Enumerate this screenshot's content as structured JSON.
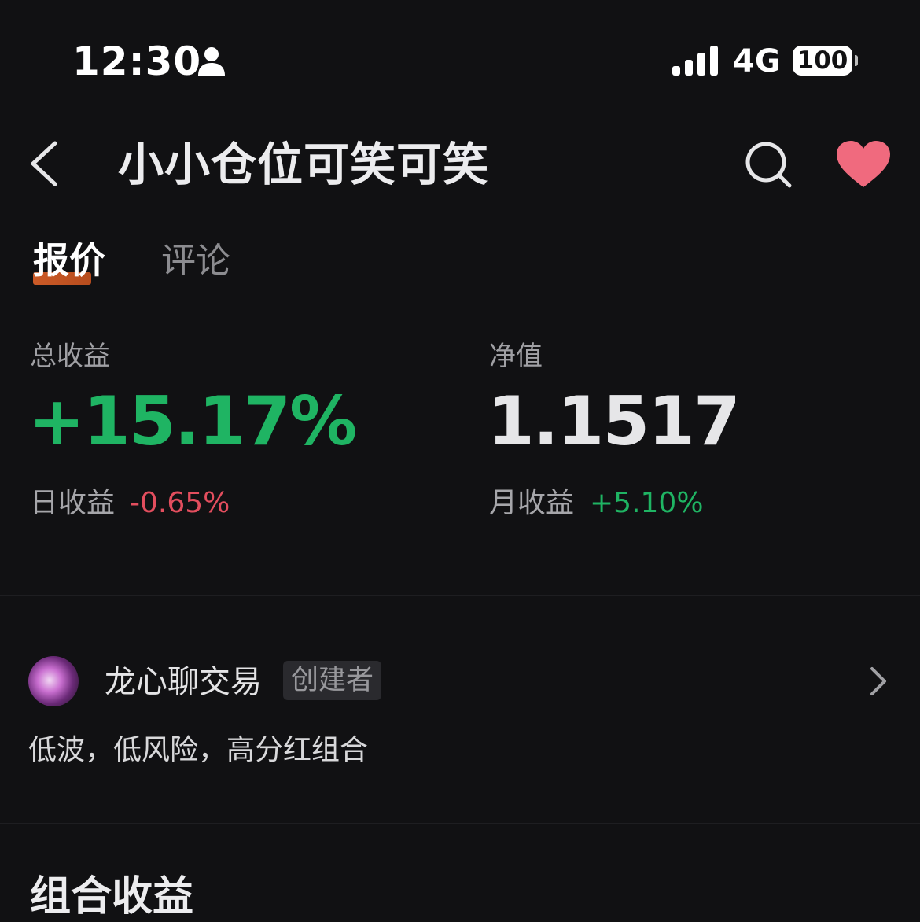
{
  "status_bar": {
    "time": "12:30",
    "network": "4G",
    "battery": "100"
  },
  "header": {
    "title": "小小仓位可笑可笑"
  },
  "tabs": [
    {
      "label": "报价",
      "active": true
    },
    {
      "label": "评论",
      "active": false
    }
  ],
  "stats": {
    "total_return_label": "总收益",
    "total_return_value": "+15.17%",
    "nav_label": "净值",
    "nav_value": "1.1517",
    "daily_return_label": "日收益",
    "daily_return_value": "-0.65%",
    "monthly_return_label": "月收益",
    "monthly_return_value": "+5.10%"
  },
  "creator": {
    "name": "龙心聊交易",
    "badge": "创建者",
    "description": "低波，低风险，高分红组合"
  },
  "section": {
    "title": "组合收益"
  },
  "colors": {
    "background": "#111113",
    "positive": "#1fb463",
    "negative": "#e34e5e",
    "favorite": "#f06a7e",
    "tab_accent": "#e0632a"
  },
  "icons": [
    "person-icon",
    "signal-icon",
    "back-icon",
    "search-icon",
    "heart-icon",
    "chevron-right-icon"
  ]
}
